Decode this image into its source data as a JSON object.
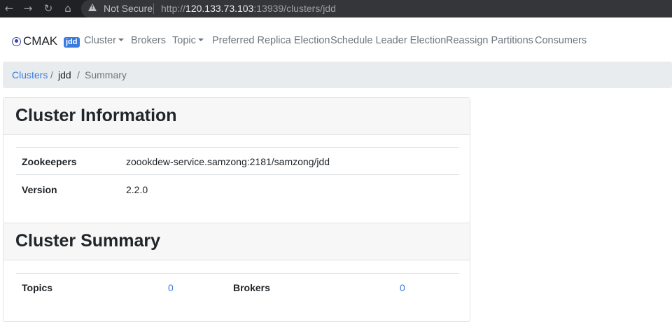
{
  "browser": {
    "security_label": "Not Secure",
    "url_scheme": "http://",
    "url_host": "120.133.73.103",
    "url_rest": ":13939/clusters/jdd"
  },
  "navbar": {
    "brand": "CMAK",
    "cluster_badge": "jdd",
    "links": [
      "Cluster",
      "Brokers",
      "Topic",
      "Preferred Replica Election",
      "Schedule Leader Election",
      "Reassign Partitions",
      "Consumers"
    ]
  },
  "breadcrumb": {
    "clusters": "Clusters",
    "separator": "/",
    "cluster": "jdd",
    "current": "Summary"
  },
  "cluster_information": {
    "title": "Cluster Information",
    "rows": [
      {
        "label": "Zookeepers",
        "value": "zoookdew-service.samzong:2181/samzong/jdd"
      },
      {
        "label": "Version",
        "value": "2.2.0"
      }
    ]
  },
  "cluster_summary": {
    "title": "Cluster Summary",
    "topics_label": "Topics",
    "topics_value": "0",
    "brokers_label": "Brokers",
    "brokers_value": "0"
  },
  "colors": {
    "link": "#3a7be0",
    "badge": "#3a7be0",
    "breadcrumb_bg": "#e9ecef",
    "card_header_bg": "#f7f7f7"
  }
}
